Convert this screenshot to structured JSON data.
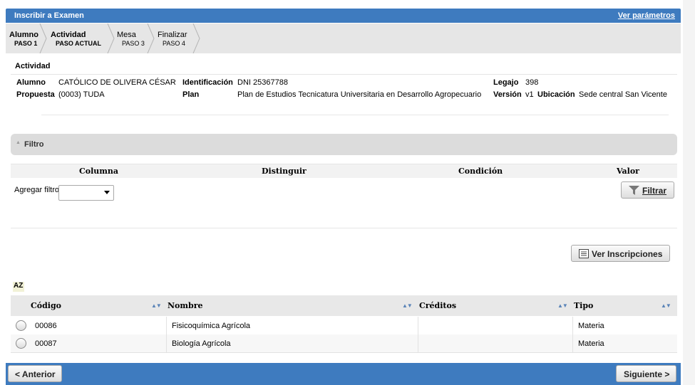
{
  "header": {
    "title": "Inscribir a Examen",
    "params_link": "Ver parámetros"
  },
  "steps": [
    {
      "name": "Alumno",
      "num": "PASO 1"
    },
    {
      "name": "Actividad",
      "num": "PASO ACTUAL"
    },
    {
      "name": "Mesa",
      "num": "PASO 3"
    },
    {
      "name": "Finalizar",
      "num": "PASO 4"
    }
  ],
  "actividad": {
    "section_title": "Actividad",
    "alumno_label": "Alumno",
    "alumno_value": "CATÓLICO DE OLIVERA CÉSAR",
    "identificacion_label": "Identificación",
    "identificacion_value": "DNI 25367788",
    "legajo_label": "Legajo",
    "legajo_value": "398",
    "propuesta_label": "Propuesta",
    "propuesta_value": "(0003) TUDA",
    "plan_label": "Plan",
    "plan_value": "Plan de Estudios Tecnicatura Universitaria en Desarrollo Agropecuario",
    "version_label": "Versión",
    "version_value": "v1",
    "ubicacion_label": "Ubicación",
    "ubicacion_value": "Sede central San Vicente"
  },
  "filtro": {
    "title": "Filtro",
    "col_columna": "Columna",
    "col_distinguir": "Distinguir",
    "col_condicion": "Condición",
    "col_valor": "Valor",
    "agregar_label": "Agregar filtro",
    "select_value": "",
    "filtrar_button": "Filtrar"
  },
  "ver_inscripciones_button": "Ver Inscripciones",
  "sort_icon_text": "AZ",
  "table": {
    "headers": [
      "Código",
      "Nombre",
      "Créditos",
      "Tipo"
    ],
    "rows": [
      {
        "codigo": "00086",
        "nombre": "Fisicoquímica Agrícola",
        "creditos": "",
        "tipo": "Materia"
      },
      {
        "codigo": "00087",
        "nombre": "Biología Agrícola",
        "creditos": "",
        "tipo": "Materia"
      }
    ]
  },
  "footer": {
    "anterior_button": "< Anterior",
    "siguiente_button": "Siguiente >"
  },
  "colors": {
    "accent": "#3e7bbf",
    "steps_bg": "#e6e6e6",
    "filter_bg": "#dcdcdc"
  }
}
